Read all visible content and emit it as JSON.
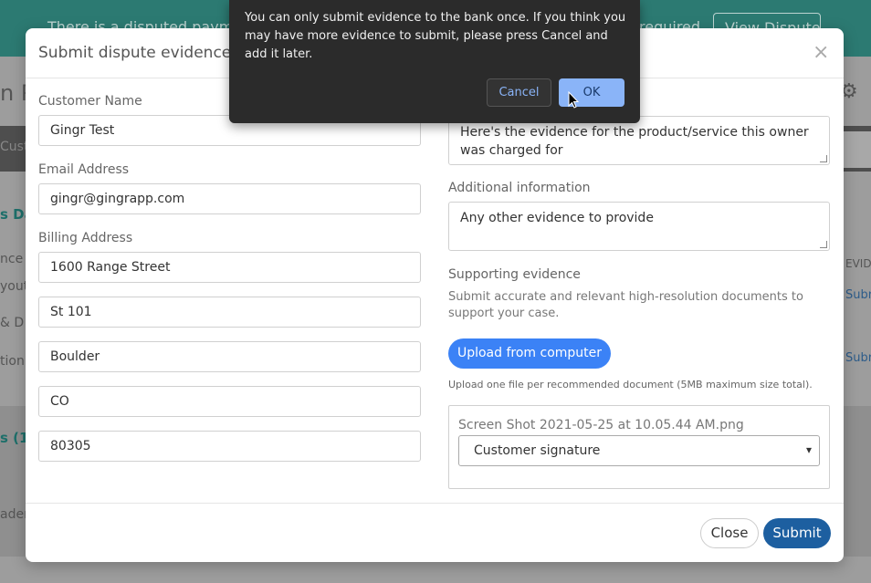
{
  "background": {
    "banner_text": "There is a disputed payme",
    "banner_text_right": "required",
    "view_dispute_button": "View Dispute",
    "page_title": "n P",
    "tab_label": "Cust",
    "left_labels": [
      "s Da",
      "nce",
      "yout",
      "& D",
      "tion",
      "s (1)",
      "ader"
    ],
    "right_header": "EVID",
    "right_links": [
      "Subr",
      "Subr"
    ]
  },
  "modal": {
    "title": "Submit dispute evidence",
    "close_symbol": "×",
    "customer_name_label": "Customer Name",
    "customer_name_value": "Gingr Test",
    "email_label": "Email Address",
    "email_value": "gingr@gingrapp.com",
    "billing_label": "Billing Address",
    "billing_line1": "1600 Range Street",
    "billing_line2": "St 101",
    "billing_city": "Boulder",
    "billing_state": "CO",
    "billing_zip": "80305",
    "product_description_value": "Here's the evidence for the product/service this owner was charged for",
    "additional_info_label": "Additional information",
    "additional_info_value": "Any other evidence to provide",
    "supporting_label": "Supporting evidence",
    "supporting_help": "Submit accurate and relevant high-resolution documents to support your case.",
    "upload_button": "Upload from computer",
    "upload_help": "Upload one file per recommended document (5MB maximum size total).",
    "file_name": "Screen Shot 2021-05-25 at 10.05.44 AM.png",
    "document_type_selected": "Customer signature",
    "close_button": "Close",
    "submit_button": "Submit"
  },
  "confirm_dialog": {
    "message": "You can only submit evidence to the bank once. If you think you may have more evidence to submit, please press Cancel and add it later.",
    "cancel_button": "Cancel",
    "ok_button": "OK"
  }
}
